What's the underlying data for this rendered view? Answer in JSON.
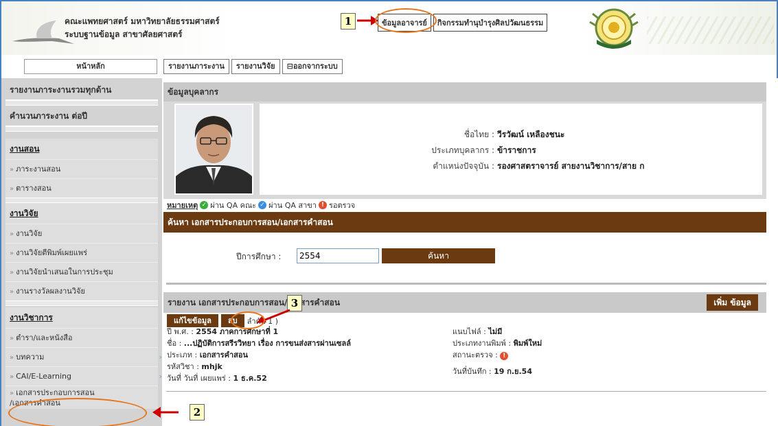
{
  "header": {
    "title_line1": "คณะแพทยศาสตร์ มหาวิทยาลัยธรรมศาสตร์",
    "title_line2": "ระบบฐานข้อมูล สาขาศัลยศาสตร์",
    "top_links": [
      "ข้อมูลอาจารย์",
      "กิจกรรมทำนุบำรุงศิลปวัฒนธรรม"
    ]
  },
  "callouts": [
    "1",
    "2",
    "3"
  ],
  "nav": {
    "home": "หน้าหลัก",
    "tabs": [
      "รายงานภาระงาน",
      "รายงานวิจัย",
      "ออกจากระบบ"
    ]
  },
  "sidebar": {
    "headers": [
      "รายงานภาระงานรวมทุกด้าน",
      "คำนวนภาระงาน ต่อปี"
    ],
    "sections": [
      {
        "title": "งานสอน",
        "items": [
          "ภาระงานสอน",
          "ตารางสอน"
        ]
      },
      {
        "title": "งานวิจัย",
        "items": [
          "งานวิจัย",
          "งานวิจัยตีพิมพ์เผยแพร่",
          "งานวิจัยนำเสนอในการประชุม",
          "งานรางวัลผลงานวิจัย"
        ]
      },
      {
        "title": "งานวิชาการ",
        "items": [
          "ตำรา/และหนังสือ",
          "บทความ",
          "CAI/E-Learning",
          "เอกสารประกอบการสอน",
          "/เอกสารคำสอน"
        ]
      }
    ]
  },
  "profile": {
    "panel_title": "ข้อมูลบุคลากร",
    "name_label": "ชื่อไทย :",
    "name_value": "วีรวัฒน์ เหลืองชนะ",
    "type_label": "ประเภทบุคลากร :",
    "type_value": "ข้าราชการ",
    "position_label": "ตำแหน่งปัจจุบัน :",
    "position_value": "รองศาสตราจารย์ สายงานวิชาการ/สาย ก"
  },
  "legend": {
    "title": "หมายเหตุ",
    "items": [
      "ผ่าน QA คณะ",
      "ผ่าน QA สาขา",
      "รอตรวจ"
    ]
  },
  "search": {
    "bar_title": "ค้นหา เอกสารประกอบการสอน/เอกสารคำสอน",
    "year_label": "ปีการศึกษา :",
    "year_value": "2554",
    "button": "ค้นหา"
  },
  "report": {
    "bar_title": "รายงาน เอกสารประกอบการสอน/เอกสารคำสอน",
    "add_button": "เพิ่ม ข้อมูล",
    "edit_button": "แก้ไขข้อมูล",
    "delete_button": "ลบ",
    "order_note": "ลำดับ 1 )",
    "fields": {
      "year_label": "ปี พ.ศ. :",
      "year_value": "2554 ภาคการศึกษาที่ 1",
      "name_label": "ชื่อ :",
      "name_value": "...ปฏิบัติการสรีรวิทยา เรื่อง การขนส่งสารผ่านเซลล์",
      "type_label": "ประเภท :",
      "type_value": "เอกสารคำสอน",
      "code_label": "รหัสวิชา :",
      "code_value": "mhjk",
      "date_label": "วันที่ วันที่ เผยแพร่ :",
      "date_value": "1 ธ.ค.52",
      "attach_label": "แนบไฟล์ :",
      "attach_value": "ไม่มี",
      "pub_label": "ประเภทงานพิมพ์ :",
      "pub_value": "พิมพ์ใหม่",
      "status_label": "สถานะตรวจ :",
      "saved_label": "วันที่บันทึก :",
      "saved_value": "19 ก.ย.54"
    }
  },
  "colors": {
    "accent_brown": "#6b3a10",
    "annotation_orange": "#e8741a",
    "annotation_red": "#cc0000",
    "frame_blue": "#4a7fc1"
  }
}
